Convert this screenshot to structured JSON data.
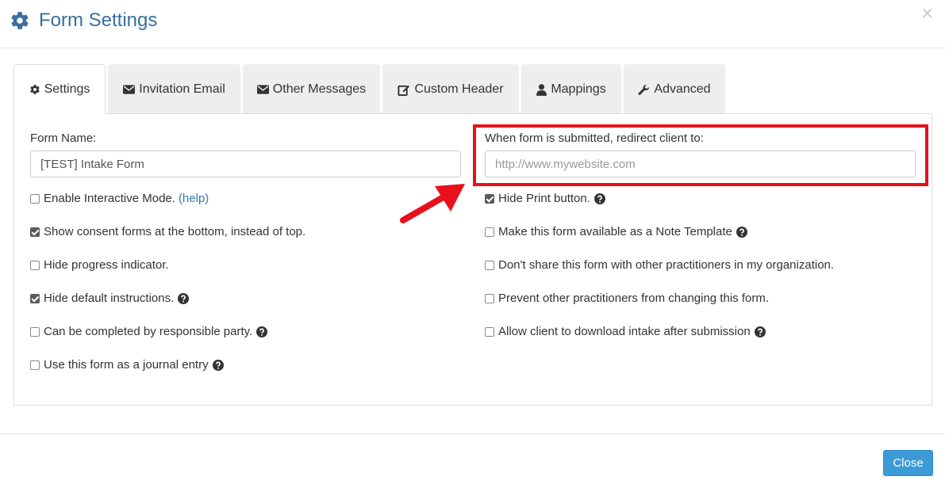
{
  "modal": {
    "title": "Form Settings",
    "close_glyph": "×",
    "accent_color": "#3a6f9e"
  },
  "tabs": [
    {
      "label": "Settings",
      "icon": "gear-icon",
      "active": true
    },
    {
      "label": "Invitation Email",
      "icon": "envelope-icon"
    },
    {
      "label": "Other Messages",
      "icon": "envelope-icon"
    },
    {
      "label": "Custom Header",
      "icon": "edit-icon"
    },
    {
      "label": "Mappings",
      "icon": "user-icon"
    },
    {
      "label": "Advanced",
      "icon": "wrench-icon"
    }
  ],
  "settings": {
    "form_name_label": "Form Name:",
    "form_name_value": "[TEST] Intake Form",
    "redirect_label": "When form is submitted, redirect client to:",
    "redirect_placeholder": "http://www.mywebsite.com",
    "redirect_value": "",
    "left_options": [
      {
        "label": "Enable Interactive Mode.",
        "checked": false,
        "link": "(help)"
      },
      {
        "label": "Show consent forms at the bottom, instead of top.",
        "checked": true
      },
      {
        "label": "Hide progress indicator.",
        "checked": false
      },
      {
        "label": "Hide default instructions.",
        "checked": true,
        "help_icon": true
      },
      {
        "label": "Can be completed by responsible party.",
        "checked": false,
        "help_icon": true
      },
      {
        "label": "Use this form as a journal entry",
        "checked": false,
        "help_icon": true
      }
    ],
    "right_options": [
      {
        "label": "Hide Print button.",
        "checked": true,
        "help_icon": true
      },
      {
        "label": "Make this form available as a Note Template",
        "checked": false,
        "help_icon": true
      },
      {
        "label": "Don't share this form with other practitioners in my organization.",
        "checked": false
      },
      {
        "label": "Prevent other practitioners from changing this form.",
        "checked": false
      },
      {
        "label": "Allow client to download intake after submission",
        "checked": false,
        "help_icon": true
      }
    ]
  },
  "footer": {
    "close_label": "Close",
    "close_color": "#3c9bd6"
  },
  "annotation": {
    "highlight_color": "#e8111b"
  }
}
